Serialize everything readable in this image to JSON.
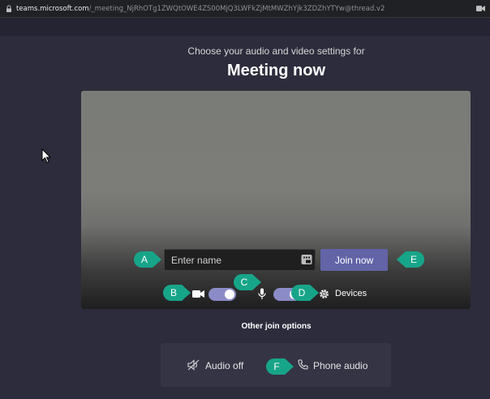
{
  "browser": {
    "url_host": "teams.microsoft.com",
    "url_path": "/_meeting_NjRhOTg1ZWQtOWE4ZS00MjQ3LWFkZjMtMWZhYjk3ZDZhYTYw@thread.v2"
  },
  "header": {
    "subtitle": "Choose your audio and video settings for",
    "title": "Meeting now"
  },
  "join": {
    "name_placeholder": "Enter name",
    "join_label": "Join now"
  },
  "controls": {
    "video_on": true,
    "mic_on": true,
    "devices_label": "Devices"
  },
  "other": {
    "label": "Other join options",
    "audio_off": "Audio off",
    "phone_audio": "Phone audio"
  },
  "callouts": {
    "a": "A",
    "b": "B",
    "c": "C",
    "d": "D",
    "e": "E",
    "f": "F",
    "color": "#17a589"
  },
  "colors": {
    "background": "#2d2c3c",
    "accent": "#6264a7",
    "toggle": "#8b8cc7"
  }
}
